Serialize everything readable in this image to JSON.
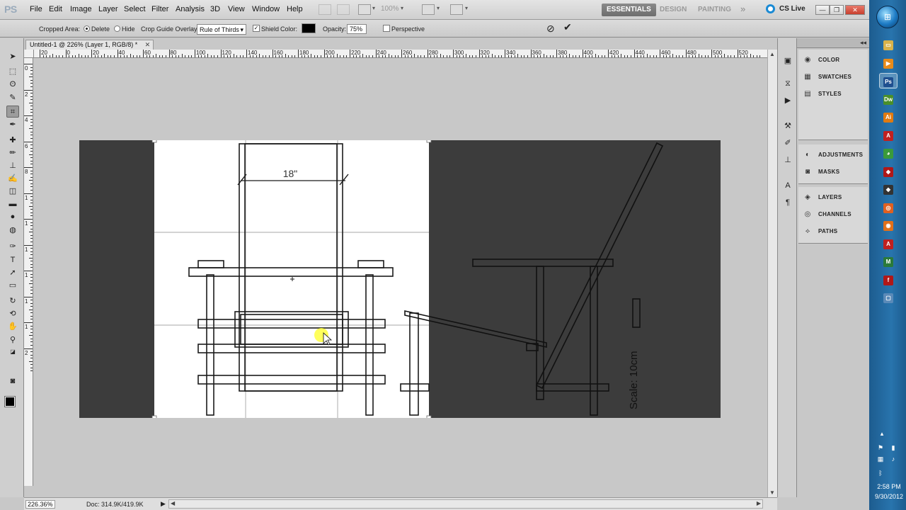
{
  "app": {
    "logo": "PS"
  },
  "menu": [
    "File",
    "Edit",
    "Image",
    "Layer",
    "Select",
    "Filter",
    "Analysis",
    "3D",
    "View",
    "Window",
    "Help"
  ],
  "menubar": {
    "zoom": "100%"
  },
  "workspaces": {
    "essentials": "ESSENTIALS",
    "design": "DESIGN",
    "painting": "PAINTING",
    "more": "»"
  },
  "cslive": "CS Live",
  "window_controls": {
    "minimize": "—",
    "restore": "❐",
    "close": "✕"
  },
  "options": {
    "cropped_area_label": "Cropped Area:",
    "delete_label": "Delete",
    "hide_label": "Hide",
    "crop_overlay_label": "Crop Guide Overlay:",
    "crop_overlay_value": "Rule of Thirds",
    "shield_label": "Shield",
    "color_label": "Color:",
    "shield_color": "#000000",
    "opacity_label": "Opacity:",
    "opacity_value": "75%",
    "perspective_label": "Perspective",
    "cropped_area_selected": "Delete",
    "shield_checked": true,
    "perspective_checked": false
  },
  "document": {
    "tab_title": "Untitled-1 @ 226% (Layer 1, RGB/8) *",
    "close": "✕"
  },
  "ruler": {
    "h_labels": [
      "20",
      "0",
      "20",
      "40",
      "60",
      "80",
      "100",
      "120",
      "140",
      "160",
      "180",
      "200",
      "220",
      "240",
      "260",
      "280",
      "300",
      "320",
      "340",
      "360",
      "380",
      "400",
      "420",
      "440",
      "460",
      "480",
      "500",
      "520"
    ],
    "v_labels": [
      "0",
      "2",
      "4",
      "6",
      "8",
      "1",
      "1",
      "1",
      "1",
      "1",
      "1",
      "2"
    ]
  },
  "canvas": {
    "dimension_label": "18\"",
    "scale_label": "Scale: 10cm",
    "colors": {
      "shield": "#3c3c3c",
      "paper": "#ffffff",
      "line": "#1a1a1a",
      "grid": "#8a8a8a",
      "cursor": "#ffff40"
    }
  },
  "status": {
    "zoom": "226.36%",
    "doc": "Doc: 314.9K/419.9K",
    "arrow": "▶"
  },
  "panels": [
    {
      "group": "colors",
      "items": [
        {
          "icon": "color-icon",
          "glyph": "◉",
          "label": "COLOR"
        },
        {
          "icon": "swatches-icon",
          "glyph": "▦",
          "label": "SWATCHES"
        },
        {
          "icon": "styles-icon",
          "glyph": "▤",
          "label": "STYLES"
        }
      ]
    },
    {
      "group": "adjust",
      "items": [
        {
          "icon": "adjustments-icon",
          "glyph": "◐",
          "label": "ADJUSTMENTS"
        },
        {
          "icon": "masks-icon",
          "glyph": "◙",
          "label": "MASKS"
        }
      ]
    },
    {
      "group": "layers",
      "items": [
        {
          "icon": "layers-icon",
          "glyph": "◈",
          "label": "LAYERS"
        },
        {
          "icon": "channels-icon",
          "glyph": "◎",
          "label": "CHANNELS"
        },
        {
          "icon": "paths-icon",
          "glyph": "⟡",
          "label": "PATHS"
        }
      ]
    }
  ],
  "panel_collapse": "◂◂",
  "taskbar": {
    "apps": [
      {
        "name": "explorer",
        "label": "▭",
        "color": "#d9b24a"
      },
      {
        "name": "media-player",
        "label": "▶",
        "color": "#e88b1a"
      },
      {
        "name": "photoshop",
        "label": "Ps",
        "color": "#1f4f8f"
      },
      {
        "name": "dreamweaver",
        "label": "Dw",
        "color": "#4a8f2a"
      },
      {
        "name": "illustrator",
        "label": "Ai",
        "color": "#e07a10"
      },
      {
        "name": "acrobat",
        "label": "A",
        "color": "#c02020"
      },
      {
        "name": "chrome",
        "label": "◕",
        "color": "#3a9a3a"
      },
      {
        "name": "app-red",
        "label": "◆",
        "color": "#b01818"
      },
      {
        "name": "app-dark",
        "label": "◆",
        "color": "#333333"
      },
      {
        "name": "app-ubuntu",
        "label": "◎",
        "color": "#e06020"
      },
      {
        "name": "firefox",
        "label": "◉",
        "color": "#e0701a"
      },
      {
        "name": "reader",
        "label": "A",
        "color": "#c02020"
      },
      {
        "name": "app-m",
        "label": "M",
        "color": "#2a7a3a"
      },
      {
        "name": "flash",
        "label": "f",
        "color": "#b01818"
      },
      {
        "name": "chat",
        "label": "▢",
        "color": "#5a8ab8"
      }
    ],
    "clock_time": "2:58 PM",
    "clock_date": "9/30/2012"
  }
}
